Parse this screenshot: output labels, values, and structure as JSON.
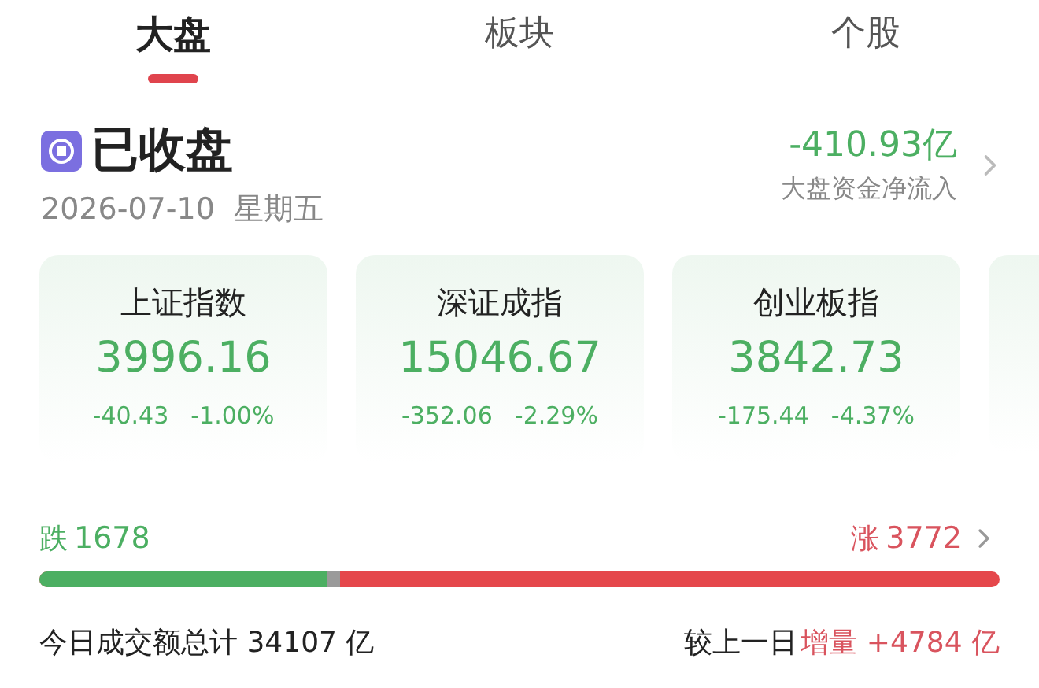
{
  "tabs": [
    {
      "label": "大盘",
      "selected": true
    },
    {
      "label": "板块",
      "selected": false
    },
    {
      "label": "个股",
      "selected": false
    }
  ],
  "status": {
    "title": "已收盘",
    "date": "2026-07-10",
    "weekday": "星期五",
    "net_flow": "-410.93亿",
    "net_flow_label": "大盘资金净流入"
  },
  "indices": [
    {
      "name": "上证指数",
      "value": "3996.16",
      "change": "-40.43",
      "percent": "-1.00%"
    },
    {
      "name": "深证成指",
      "value": "15046.67",
      "change": "-352.06",
      "percent": "-2.29%"
    },
    {
      "name": "创业板指",
      "value": "3842.73",
      "change": "-175.44",
      "percent": "-4.37%"
    }
  ],
  "breadth": {
    "fall_label": "跌",
    "fall_count": "1678",
    "rise_label": "涨",
    "rise_count": "3772",
    "level": 0.3
  },
  "turnover": {
    "total": "今日成交额总计 34107 亿",
    "compare_label": "较上一日",
    "increase": "增量 +4784 亿"
  }
}
